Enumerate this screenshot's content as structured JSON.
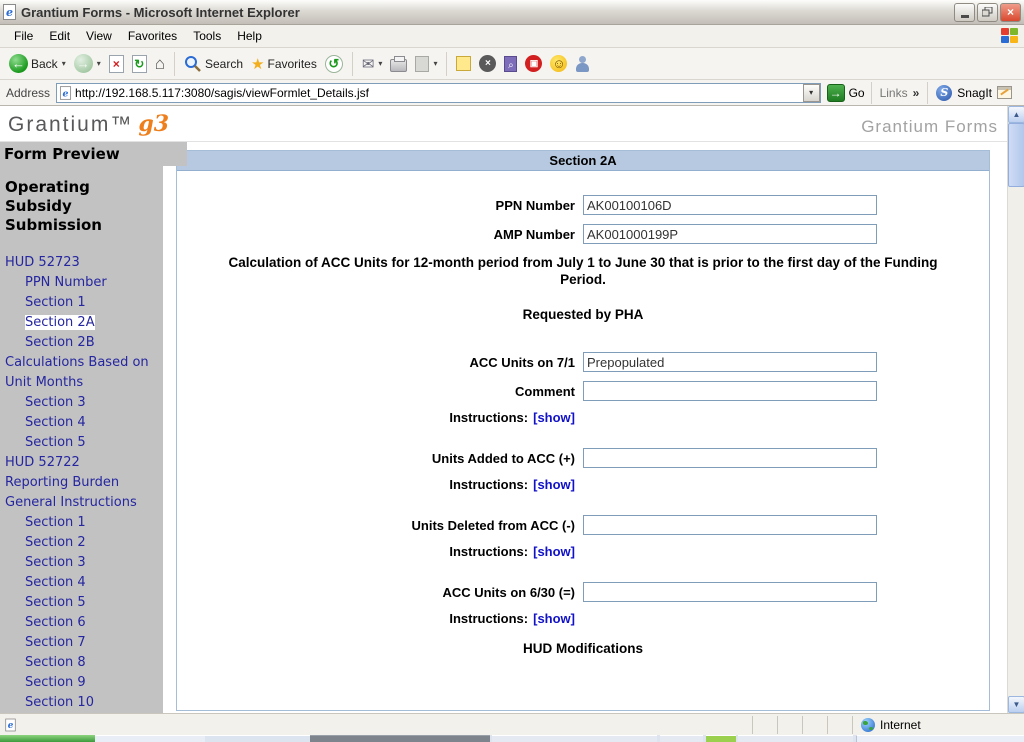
{
  "window": {
    "title": "Grantium Forms - Microsoft Internet Explorer"
  },
  "menu": {
    "items": [
      "File",
      "Edit",
      "View",
      "Favorites",
      "Tools",
      "Help"
    ]
  },
  "toolbar": {
    "back_label": "Back",
    "search_label": "Search",
    "favorites_label": "Favorites"
  },
  "address": {
    "label": "Address",
    "url": "http://192.168.5.117:3080/sagis/viewFormlet_Details.jsf",
    "go_label": "Go",
    "links_label": "Links",
    "snagit_label": "SnagIt"
  },
  "banner": {
    "logo_text": "Grantium™",
    "logo_mark": "g3",
    "app_title": "Grantium Forms"
  },
  "sidebar": {
    "heading": "Form Preview",
    "form_title": "Operating Subsidy Submission",
    "items": [
      {
        "label": "HUD 52723"
      },
      {
        "label": "PPN Number"
      },
      {
        "label": "Section 1"
      },
      {
        "label": "Section 2A"
      },
      {
        "label": "Section 2B"
      },
      {
        "label": "Calculations Based on Unit Months"
      },
      {
        "label": "Section 3"
      },
      {
        "label": "Section 4"
      },
      {
        "label": "Section 5"
      },
      {
        "label": "HUD 52722"
      },
      {
        "label": "Reporting Burden"
      },
      {
        "label": "General Instructions"
      },
      {
        "label": "Section 1"
      },
      {
        "label": "Section 2"
      },
      {
        "label": "Section 3"
      },
      {
        "label": "Section 4"
      },
      {
        "label": "Section 5"
      },
      {
        "label": "Section 6"
      },
      {
        "label": "Section 7"
      },
      {
        "label": "Section 8"
      },
      {
        "label": "Section 9"
      },
      {
        "label": "Section 10"
      }
    ]
  },
  "form": {
    "section_header": "Section 2A",
    "ppn": {
      "label": "PPN Number",
      "value": "AK00100106D"
    },
    "amp": {
      "label": "AMP Number",
      "value": "AK001000199P"
    },
    "calc_text": "Calculation of ACC Units for 12-month period from July 1 to June 30 that is prior to the first day of the Funding Period.",
    "requested_heading": "Requested by PHA",
    "acc_71": {
      "label": "ACC Units on 7/1",
      "value": "Prepopulated"
    },
    "comment": {
      "label": "Comment",
      "value": ""
    },
    "units_added": {
      "label": "Units Added to ACC (+)",
      "value": ""
    },
    "units_deleted": {
      "label": "Units Deleted from ACC (-)",
      "value": ""
    },
    "acc_630": {
      "label": "ACC Units on 6/30 (=)",
      "value": ""
    },
    "instructions_label": "Instructions:",
    "show_link": "[show]",
    "hud_modifications_heading": "HUD Modifications"
  },
  "statusbar": {
    "zone_label": "Internet"
  },
  "icons": {
    "back_arrow": "←",
    "forward_arrow": "→",
    "dropdown_caret": "▾",
    "stop_x": "×",
    "refresh": "↻",
    "home": "⌂",
    "favorites_star": "★",
    "history": "↺",
    "mail": "✉",
    "edit_caret": "▾",
    "circle_x": "×",
    "smiley": "☺",
    "go_arrow": "→",
    "url_caret": "▼",
    "links_chevrons": "»",
    "scroll_up": "▲",
    "scroll_down": "▼",
    "minimize": "",
    "close_x": "×"
  },
  "colors": {
    "section_header_bg": "#b7c9e0",
    "sidebar_bg": "#c2c2c2",
    "link_navy": "#2526a0",
    "show_link_blue": "#1011c8",
    "logo_orange": "#ee7f1d",
    "go_green": "#2f8a32",
    "close_red": "#d9482f"
  }
}
